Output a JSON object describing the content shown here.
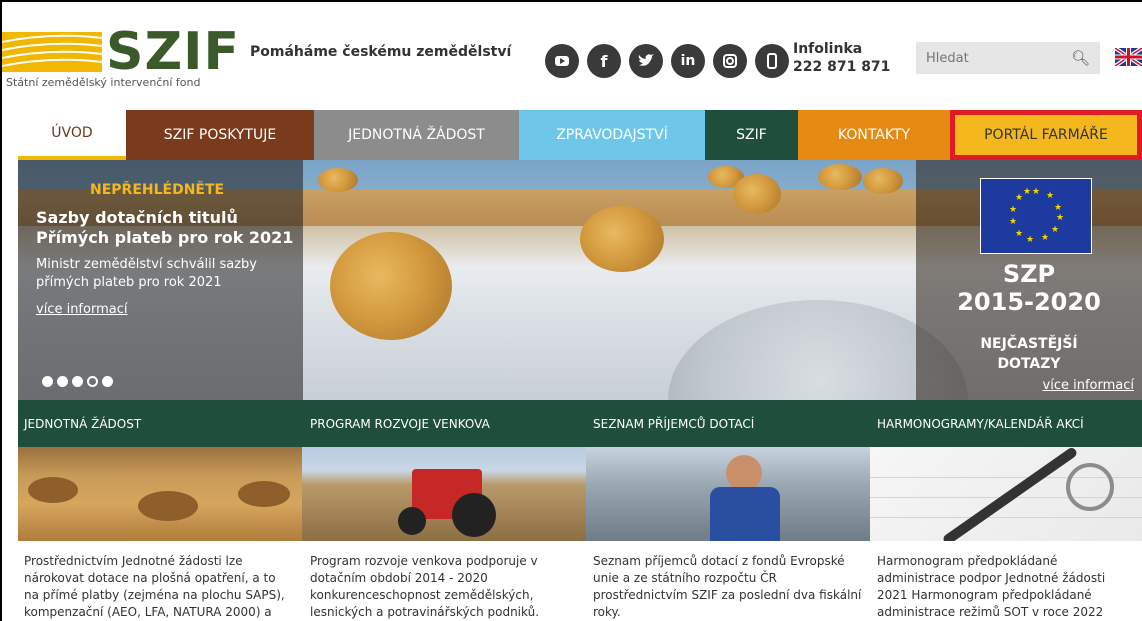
{
  "header": {
    "logo_text": "SZIF",
    "logo_subtitle": "Státní zemědělský intervenční fond",
    "tagline": "Pomáháme českému zemědělství",
    "social_icons": [
      "youtube-icon",
      "facebook-icon",
      "twitter-icon",
      "linkedin-icon",
      "instagram-icon",
      "mobile-icon"
    ],
    "infolinka_label": "Infolinka",
    "infolinka_number": "222 871 871",
    "search_placeholder": "Hledat"
  },
  "nav": {
    "items": [
      {
        "label": "ÚVOD"
      },
      {
        "label": "SZIF POSKYTUJE"
      },
      {
        "label": "JEDNOTNÁ ŽÁDOST"
      },
      {
        "label": "ZPRAVODAJSTVÍ"
      },
      {
        "label": "SZIF"
      },
      {
        "label": "KONTAKTY"
      },
      {
        "label": "PORTÁL FARMÁŘE"
      }
    ]
  },
  "hero": {
    "kicker": "NEPŘEHLÉDNĚTE",
    "title": "Sazby dotačních titulů Přímých plateb pro rok 2021",
    "description": "Ministr zemědělství schválil sazby přímých plateb pro rok 2021",
    "more": "více informací",
    "slide_count": 5,
    "active_slide": 4
  },
  "side_banner": {
    "title": "SZP",
    "years": "2015-2020",
    "faq_line1": "NEJČASTĚJŠÍ",
    "faq_line2": "DOTAZY",
    "more": "více informací"
  },
  "cards": [
    {
      "title": "JEDNOTNÁ ŽÁDOST",
      "text": "Prostřednictvím Jednotné žádosti lze nárokovat dotace na plošná opatření, a to na přímé platby (zejména na plochu SAPS), kompenzační (AEO, LFA, NATURA 2000) a"
    },
    {
      "title": "PROGRAM ROZVOJE VENKOVA",
      "text": "Program rozvoje venkova podporuje v dotačním období 2014 - 2020 konkurenceschopnost zemědělských, lesnických a potravinářských podniků."
    },
    {
      "title": "SEZNAM PŘÍJEMCŮ DOTACÍ",
      "text": "Seznam příjemců dotací z fondů Evropské unie a ze státního rozpočtu ČR prostřednictvím SZIF za poslední dva fiskální roky."
    },
    {
      "title": "HARMONOGRAMY/KALENDÁŘ AKCÍ",
      "text": "Harmonogram předpokládané administrace podpor Jednotné žádosti 2021 Harmonogram předpokládané administrace režimů SOT v roce 2022"
    }
  ]
}
